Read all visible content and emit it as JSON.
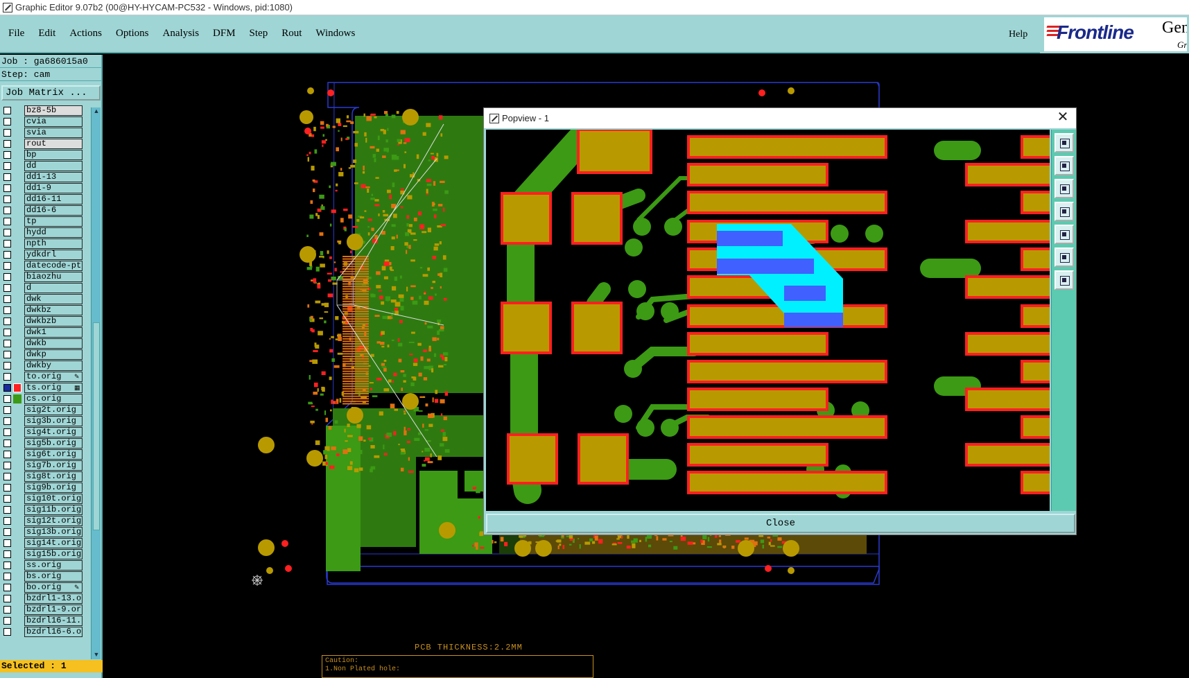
{
  "window": {
    "title": "Graphic Editor 9.07b2 (00@HY-HYCAM-PC532 - Windows, pid:1080)"
  },
  "menu": [
    "File",
    "Edit",
    "Actions",
    "Options",
    "Analysis",
    "DFM",
    "Step",
    "Rout",
    "Windows"
  ],
  "help_label": "Help",
  "logo": {
    "brand": "Frontline",
    "gen": "Gen",
    "gra": "Gra"
  },
  "panel": {
    "job": "Job : ga686015a0",
    "step": "Step: cam",
    "job_matrix": "Job Matrix ...",
    "selected": "Selected : 1"
  },
  "layers": [
    {
      "name": "bz8-5b",
      "state": "off",
      "hl": true
    },
    {
      "name": "cvia",
      "state": "off"
    },
    {
      "name": "svia",
      "state": "off"
    },
    {
      "name": "rout",
      "state": "off",
      "hl": true
    },
    {
      "name": "bp",
      "state": "off"
    },
    {
      "name": "dd",
      "state": "off"
    },
    {
      "name": "dd1-13",
      "state": "off"
    },
    {
      "name": "dd1-9",
      "state": "off"
    },
    {
      "name": "dd16-11",
      "state": "off"
    },
    {
      "name": "dd16-6",
      "state": "off"
    },
    {
      "name": "tp",
      "state": "off"
    },
    {
      "name": "hydd",
      "state": "off"
    },
    {
      "name": "npth",
      "state": "off"
    },
    {
      "name": "ydkdrl",
      "state": "off"
    },
    {
      "name": "datecode-ptc",
      "state": "off"
    },
    {
      "name": "biaozhu",
      "state": "off"
    },
    {
      "name": "d",
      "state": "off"
    },
    {
      "name": "dwk",
      "state": "off"
    },
    {
      "name": "dwkbz",
      "state": "off"
    },
    {
      "name": "dwkbzb",
      "state": "off"
    },
    {
      "name": "dwk1",
      "state": "off"
    },
    {
      "name": "dwkb",
      "state": "off"
    },
    {
      "name": "dwkp",
      "state": "off"
    },
    {
      "name": "dwkby",
      "state": "off"
    },
    {
      "name": "to.orig",
      "state": "off",
      "sym": "✎"
    },
    {
      "name": "ts.orig",
      "state": "work",
      "sym": "▦"
    },
    {
      "name": "cs.orig",
      "state": "green"
    },
    {
      "name": "sig2t.orig",
      "state": "off"
    },
    {
      "name": "sig3b.orig",
      "state": "off"
    },
    {
      "name": "sig4t.orig",
      "state": "off"
    },
    {
      "name": "sig5b.orig",
      "state": "off"
    },
    {
      "name": "sig6t.orig",
      "state": "off"
    },
    {
      "name": "sig7b.orig",
      "state": "off"
    },
    {
      "name": "sig8t.orig",
      "state": "off"
    },
    {
      "name": "sig9b.orig",
      "state": "off"
    },
    {
      "name": "sig10t.orig",
      "state": "off"
    },
    {
      "name": "sig11b.orig",
      "state": "off"
    },
    {
      "name": "sig12t.orig",
      "state": "off"
    },
    {
      "name": "sig13b.orig",
      "state": "off"
    },
    {
      "name": "sig14t.orig",
      "state": "off"
    },
    {
      "name": "sig15b.orig",
      "state": "off"
    },
    {
      "name": "ss.orig",
      "state": "off"
    },
    {
      "name": "bs.orig",
      "state": "off"
    },
    {
      "name": "bo.orig",
      "state": "off",
      "sym": "✎"
    },
    {
      "name": "bzdrl1-13.o",
      "state": "off"
    },
    {
      "name": "bzdrl1-9.or",
      "state": "off"
    },
    {
      "name": "bzdrl16-11.",
      "state": "off"
    },
    {
      "name": "bzdrl16-6.o",
      "state": "off"
    }
  ],
  "pcb": {
    "caption": "PCB THICKNESS:2.2MM",
    "caution_line1": "Caution:",
    "caution_line2": "1.Non Plated hole:"
  },
  "popview": {
    "title": "Popview - 1",
    "close_label": "Close",
    "tools": [
      "zoom-window-icon",
      "zoom-in-icon",
      "zoom-out-icon",
      "pan-left-icon",
      "pan-right-icon",
      "fit-icon",
      "home-icon"
    ]
  },
  "colors": {
    "panel_bg": "#9fd5d5",
    "copper_green": "#3c9a14",
    "pad_gold": "#b89a00",
    "mask_red": "#ff2020",
    "highlight_cyan": "#00f0ff",
    "highlight_blue": "#4060ff",
    "selected_bar": "#f5c020"
  }
}
